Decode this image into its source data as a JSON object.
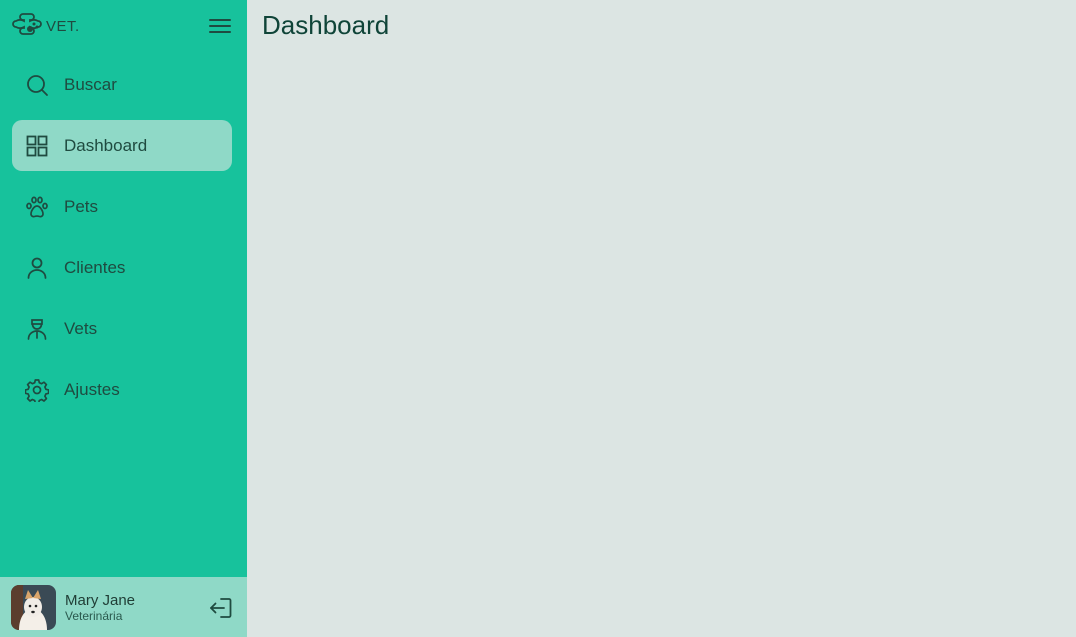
{
  "brand": {
    "name": "VET.",
    "logo_icon": "paw-cross-logo-icon"
  },
  "header": {
    "menu_icon": "hamburger-menu-icon"
  },
  "sidebar": {
    "items": [
      {
        "label": "Buscar",
        "icon": "search-icon",
        "active": false
      },
      {
        "label": "Dashboard",
        "icon": "grid-icon",
        "active": true
      },
      {
        "label": "Pets",
        "icon": "paw-icon",
        "active": false
      },
      {
        "label": "Clientes",
        "icon": "user-icon",
        "active": false
      },
      {
        "label": "Vets",
        "icon": "veterinarian-icon",
        "active": false
      },
      {
        "label": "Ajustes",
        "icon": "gear-icon",
        "active": false
      }
    ]
  },
  "user": {
    "name": "Mary Jane",
    "role": "Veterinária",
    "logout_icon": "logout-icon"
  },
  "main": {
    "title": "Dashboard"
  },
  "colors": {
    "sidebar_bg": "#17c29c",
    "active_bg": "#8fd9c7",
    "main_bg": "#dce5e3",
    "text_dark": "#0f4438"
  }
}
